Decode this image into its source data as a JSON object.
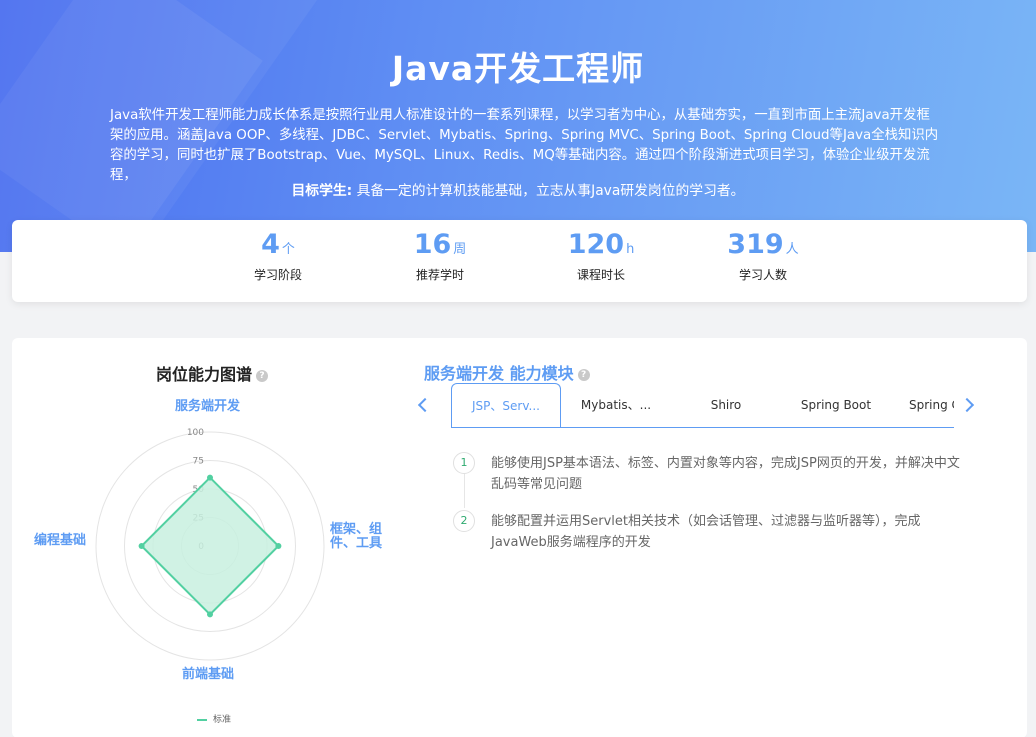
{
  "hero": {
    "title": "Java开发工程师",
    "description": "Java软件开发工程师能力成长体系是按照行业用人标准设计的一套系列课程，以学习者为中心，从基础夯实，一直到市面上主流Java开发框架的应用。涵盖Java OOP、多线程、JDBC、Servlet、Mybatis、Spring、Spring MVC、Spring Boot、Spring Cloud等Java全栈知识内容的学习，同时也扩展了Bootstrap、Vue、MySQL、Linux、Redis、MQ等基础内容。通过四个阶段渐进式项目学习，体验企业级开发流程，",
    "target_label": "目标学生:",
    "target_text": "具备一定的计算机技能基础，立志从事Java研发岗位的学习者。"
  },
  "stats": [
    {
      "value": "4",
      "unit": "个",
      "label": "学习阶段"
    },
    {
      "value": "16",
      "unit": "周",
      "label": "推荐学时"
    },
    {
      "value": "120",
      "unit": "h",
      "label": "课程时长"
    },
    {
      "value": "319",
      "unit": "人",
      "label": "学习人数"
    }
  ],
  "ability_map": {
    "title": "岗位能力图谱",
    "help_icon": "?",
    "axes": [
      "服务端开发",
      "框架、组件、工具",
      "前端基础",
      "编程基础"
    ],
    "ticks": [
      "100",
      "75",
      "50",
      "25",
      "0"
    ],
    "legend": "标准"
  },
  "chart_data": {
    "type": "radar",
    "categories": [
      "服务端开发",
      "框架、组件、工具",
      "前端基础",
      "编程基础"
    ],
    "series": [
      {
        "name": "标准",
        "values": [
          60,
          60,
          60,
          60
        ]
      }
    ],
    "range": [
      0,
      100
    ],
    "ticks": [
      0,
      25,
      50,
      75,
      100
    ],
    "legend_position": "bottom",
    "colors": {
      "stroke": "#52d0a1",
      "fill": "#c8f0df"
    }
  },
  "module": {
    "title": "服务端开发 能力模块",
    "help_icon": "?",
    "tabs": [
      "JSP、Serv...",
      "Mybatis、...",
      "Shiro",
      "Spring Boot",
      "Spring Cl"
    ],
    "items": [
      {
        "num": "1",
        "text": "能够使用JSP基本语法、标签、内置对象等内容，完成JSP网页的开发，并解决中文乱码等常见问题"
      },
      {
        "num": "2",
        "text": "能够配置并运用Servlet相关技术（如会话管理、过滤器与监听器等），完成JavaWeb服务端程序的开发"
      }
    ]
  },
  "colors": {
    "accent": "#5e9cf3",
    "radar": "#52d0a1"
  }
}
